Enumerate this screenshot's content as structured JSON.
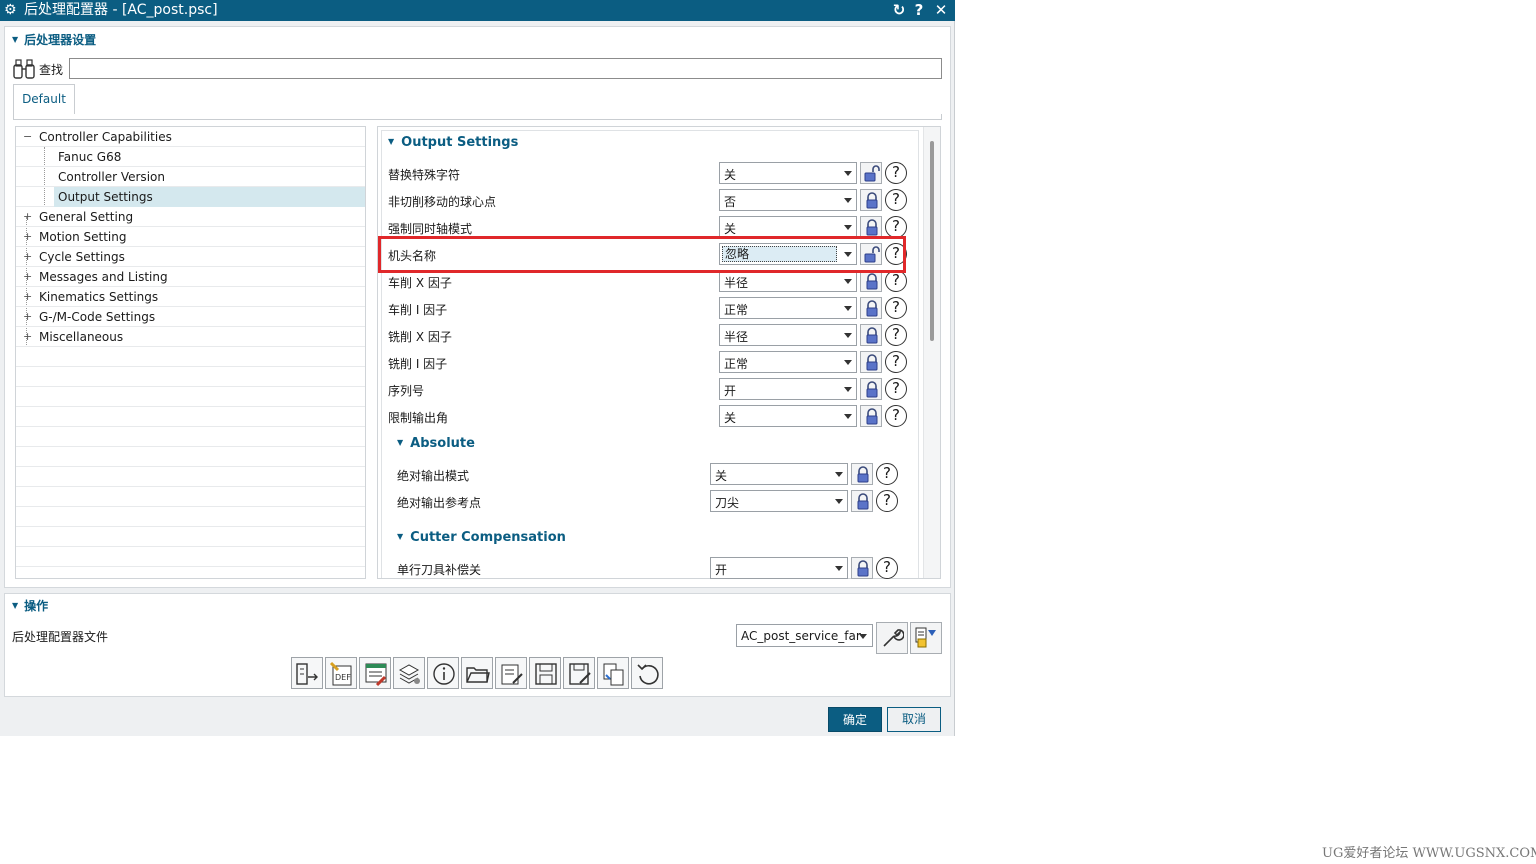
{
  "window": {
    "title": "后处理配置器 - [AC_post.psc]",
    "controls": [
      "↻",
      "?",
      "✕"
    ]
  },
  "settings_section": {
    "title": "后处理器设置",
    "find_label": "查找",
    "find_value": "",
    "tab": "Default"
  },
  "tree": {
    "items": [
      {
        "label": "Controller Capabilities",
        "expander": "−",
        "level": 0
      },
      {
        "label": "Fanuc G68",
        "expander": "",
        "level": 1
      },
      {
        "label": "Controller Version",
        "expander": "",
        "level": 1
      },
      {
        "label": "Output Settings",
        "expander": "",
        "level": 1,
        "selected": true
      },
      {
        "label": "General Setting",
        "expander": "+",
        "level": 0
      },
      {
        "label": "Motion Setting",
        "expander": "+",
        "level": 0
      },
      {
        "label": "Cycle Settings",
        "expander": "+",
        "level": 0
      },
      {
        "label": "Messages and Listing",
        "expander": "+",
        "level": 0
      },
      {
        "label": "Kinematics Settings",
        "expander": "+",
        "level": 0
      },
      {
        "label": "G-/M-Code Settings",
        "expander": "+",
        "level": 0
      },
      {
        "label": "Miscellaneous",
        "expander": "+",
        "level": 0
      }
    ]
  },
  "output_settings": {
    "title": "Output Settings",
    "rows": [
      {
        "label": "替换特殊字符",
        "value": "关",
        "lock": "unlocked"
      },
      {
        "label": "非切削移动的球心点",
        "value": "否",
        "lock": "locked"
      },
      {
        "label": "强制同时轴模式",
        "value": "关",
        "lock": "locked"
      },
      {
        "label": "机头名称",
        "value": "忽略",
        "lock": "unlocked",
        "highlighted": true
      },
      {
        "label": "车削 X 因子",
        "value": "半径",
        "lock": "locked"
      },
      {
        "label": "车削 I 因子",
        "value": "正常",
        "lock": "locked"
      },
      {
        "label": "铣削 X 因子",
        "value": "半径",
        "lock": "locked"
      },
      {
        "label": "铣削 I 因子",
        "value": "正常",
        "lock": "locked"
      },
      {
        "label": "序列号",
        "value": "开",
        "lock": "locked"
      },
      {
        "label": "限制输出角",
        "value": "关",
        "lock": "locked"
      }
    ],
    "help_glyph": "?"
  },
  "absolute": {
    "title": "Absolute",
    "rows": [
      {
        "label": "绝对输出模式",
        "value": "关",
        "lock": "locked"
      },
      {
        "label": "绝对输出参考点",
        "value": "刀尖",
        "lock": "locked"
      }
    ]
  },
  "cutter_comp": {
    "title": "Cutter Compensation",
    "rows": [
      {
        "label": "单行刀具补偿关",
        "value": "开",
        "lock": "locked"
      }
    ]
  },
  "operations": {
    "title": "操作",
    "file_label": "后处理配置器文件",
    "file_value": "AC_post_service_far",
    "toolbar": [
      "export-icon",
      "def-file-icon",
      "edit-list-icon",
      "layers-settings-icon",
      "info-icon",
      "open-folder-icon",
      "edit-file-icon",
      "save-icon",
      "save-as-icon",
      "copy-settings-icon",
      "reset-icon"
    ]
  },
  "footer": {
    "ok_label": "确定",
    "cancel_label": "取消"
  },
  "watermark": "UG爱好者论坛 WWW.UGSNX.COM",
  "colors": {
    "accent": "#0b5d82",
    "highlight_box": "#e0282a",
    "tree_selection": "#d4e8ee"
  }
}
